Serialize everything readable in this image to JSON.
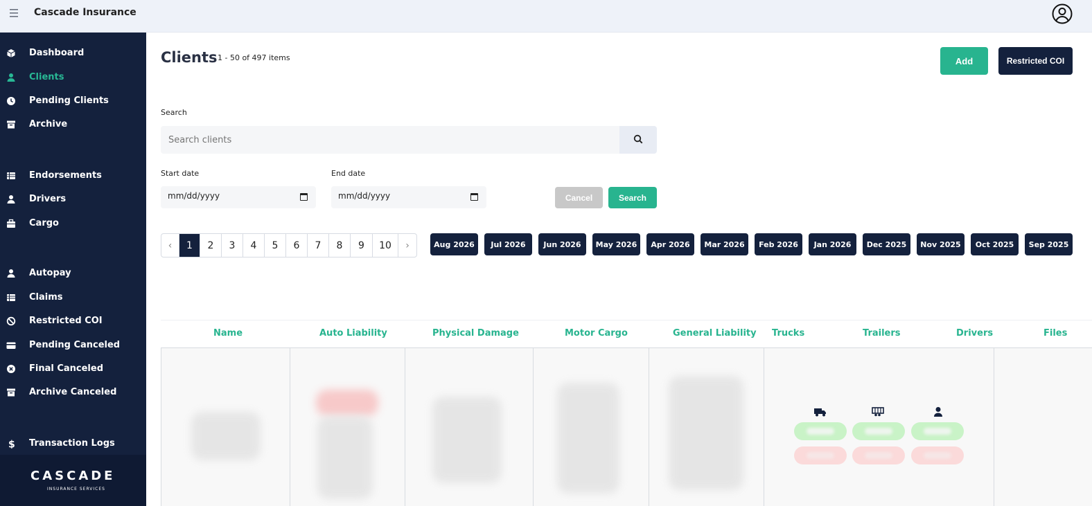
{
  "app": {
    "title": "Cascade Insurance"
  },
  "sidebar": {
    "items": [
      {
        "label": "Dashboard",
        "icon": "dashboard-cube-icon"
      },
      {
        "label": "Clients",
        "icon": "user-icon",
        "active": true
      },
      {
        "label": "Pending Clients",
        "icon": "clock-icon"
      },
      {
        "label": "Archive",
        "icon": "archive-box-icon"
      },
      {
        "label": "Endorsements",
        "icon": "table-icon"
      },
      {
        "label": "Drivers",
        "icon": "user-icon"
      },
      {
        "label": "Cargo",
        "icon": "briefcase-icon"
      },
      {
        "label": "Autopay",
        "icon": "user-icon"
      },
      {
        "label": "Claims",
        "icon": "table-icon"
      },
      {
        "label": "Restricted COI",
        "icon": "ban-icon"
      },
      {
        "label": "Pending Canceled",
        "icon": "credit-card-icon"
      },
      {
        "label": "Final Canceled",
        "icon": "x-circle-icon"
      },
      {
        "label": "Archive Canceled",
        "icon": "archive-box-icon"
      },
      {
        "label": "Transaction Logs",
        "icon": "dollar-icon"
      }
    ],
    "logo": {
      "main": "CASCADE",
      "sub": "INSURANCE SERVICES"
    }
  },
  "main": {
    "title": "Clients",
    "count": "1 - 50 of 497 items",
    "add_label": "Add",
    "restricted_label": "Restricted COI",
    "search_label": "Search",
    "search_placeholder": "Search clients",
    "start_label": "Start date",
    "end_label": "End date",
    "start_value": "mm/dd/yyyy",
    "end_value": "mm/dd/yyyy",
    "cancel_label": "Cancel",
    "search_button": "Search",
    "pages": [
      "‹",
      "1",
      "2",
      "3",
      "4",
      "5",
      "6",
      "7",
      "8",
      "9",
      "10",
      "›"
    ],
    "current_page": "1",
    "months": [
      "Aug 2026",
      "Jul 2026",
      "Jun 2026",
      "May 2026",
      "Apr 2026",
      "Mar 2026",
      "Feb 2026",
      "Jan 2026",
      "Dec 2025",
      "Nov 2025",
      "Oct 2025",
      "Sep 2025"
    ],
    "columns": [
      "Name",
      "Auto Liability",
      "Physical Damage",
      "Motor Cargo",
      "General Liability",
      "Trucks",
      "Trailers",
      "Drivers",
      "Files"
    ]
  },
  "colors": {
    "accent": "#28b48f",
    "navy": "#14213d",
    "active_nav": "#28b895"
  }
}
